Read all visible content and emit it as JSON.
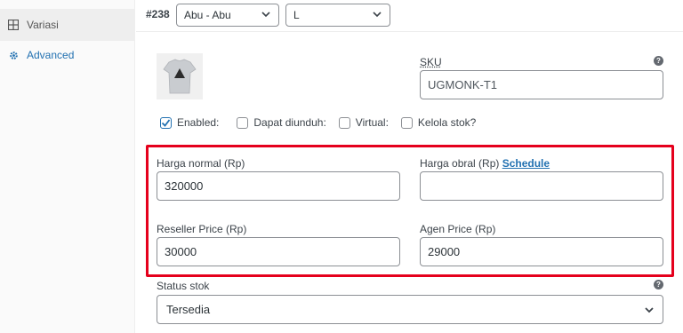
{
  "sidebar": {
    "items": [
      {
        "label": "Variasi",
        "icon": "grid-icon"
      },
      {
        "label": "Advanced",
        "icon": "gear-icon"
      }
    ]
  },
  "variation": {
    "id_label": "#238",
    "color_select": "Abu - Abu",
    "size_select": "L"
  },
  "sku": {
    "label": "SKU",
    "value": "UGMONK-T1"
  },
  "options": {
    "enabled": {
      "label": "Enabled:",
      "checked": true
    },
    "downloadable": {
      "label": "Dapat diunduh:",
      "checked": false
    },
    "virtual": {
      "label": "Virtual:",
      "checked": false
    },
    "manage_stock": {
      "label": "Kelola stok?",
      "checked": false
    }
  },
  "pricing": {
    "regular_label": "Harga normal (Rp)",
    "regular_value": "320000",
    "sale_label": "Harga obral (Rp)",
    "sale_schedule_link": "Schedule",
    "sale_value": "",
    "reseller_label": "Reseller Price (Rp)",
    "reseller_value": "30000",
    "agent_label": "Agen Price (Rp)",
    "agent_value": "29000"
  },
  "stock": {
    "label": "Status stok",
    "value": "Tersedia"
  },
  "colors": {
    "accent": "#2271b1",
    "highlight": "#e5001c"
  }
}
